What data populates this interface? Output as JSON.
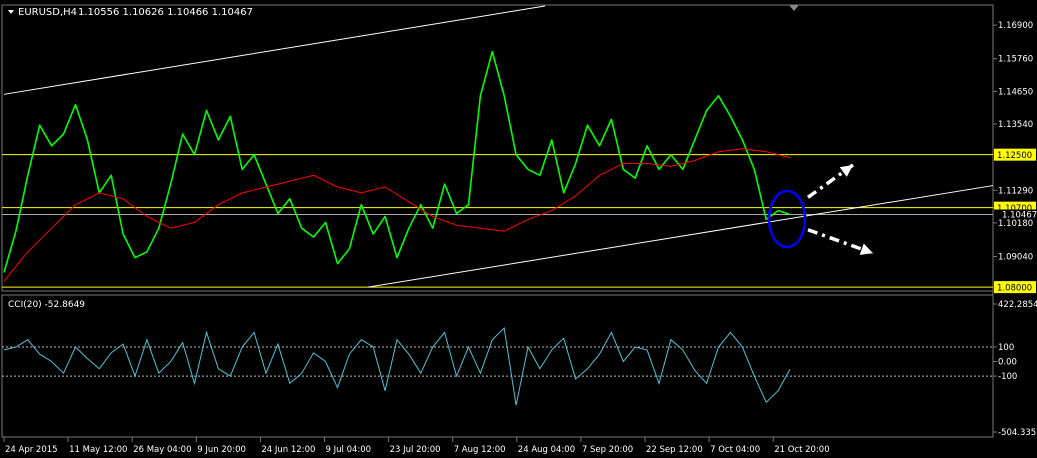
{
  "header": {
    "symbol_label": "EURUSD,H4",
    "ohlc": "1.10556 1.10626 1.10466 1.10467"
  },
  "colors": {
    "background": "#000000",
    "price": "#00ff00",
    "moving_average": "#ff0000",
    "cci": "#4fc3d9",
    "levels": "#ffff00",
    "trendlines": "#ffffff",
    "ellipse": "#0000ff",
    "axis_text": "#ffffff"
  },
  "chart_data": [
    {
      "type": "line",
      "panel": "price",
      "ylim": [
        1.0797,
        1.1755
      ],
      "y_ticks": [
        "1.16900",
        "1.15760",
        "1.14650",
        "1.13540",
        "1.11290",
        "1.10180",
        "1.09040"
      ],
      "level_labels": [
        "1.12500",
        "1.10700",
        "1.08000"
      ],
      "current_label": "1.10467",
      "horizontal_levels": [
        1.125,
        1.107,
        1.08
      ],
      "current_price": 1.10467,
      "series": [
        {
          "role": "price",
          "values": [
            1.085,
            1.099,
            1.118,
            1.135,
            1.128,
            1.132,
            1.142,
            1.13,
            1.112,
            1.118,
            1.098,
            1.09,
            1.092,
            1.1,
            1.115,
            1.132,
            1.125,
            1.14,
            1.13,
            1.138,
            1.12,
            1.125,
            1.115,
            1.105,
            1.11,
            1.1,
            1.097,
            1.102,
            1.088,
            1.093,
            1.108,
            1.098,
            1.104,
            1.09,
            1.1,
            1.108,
            1.1,
            1.115,
            1.105,
            1.108,
            1.145,
            1.16,
            1.145,
            1.125,
            1.12,
            1.118,
            1.13,
            1.112,
            1.122,
            1.135,
            1.128,
            1.137,
            1.12,
            1.117,
            1.128,
            1.12,
            1.125,
            1.12,
            1.13,
            1.14,
            1.145,
            1.138,
            1.13,
            1.12,
            1.103,
            1.106,
            1.1047
          ]
        },
        {
          "role": "moving_average",
          "values": [
            1.082,
            1.092,
            1.1,
            1.108,
            1.112,
            1.11,
            1.104,
            1.1,
            1.102,
            1.108,
            1.112,
            1.114,
            1.116,
            1.118,
            1.114,
            1.112,
            1.114,
            1.109,
            1.104,
            1.101,
            1.1,
            1.099,
            1.103,
            1.106,
            1.111,
            1.118,
            1.122,
            1.122,
            1.121,
            1.123,
            1.126,
            1.127,
            1.126,
            1.124
          ]
        }
      ],
      "trendlines": [
        {
          "start": 1.1455,
          "end": 1.1755
        },
        {
          "start": 1.08,
          "end": 1.1145
        }
      ],
      "projection_arrows": [
        {
          "direction": "up",
          "from": 1.1105,
          "to": 1.1215
        },
        {
          "direction": "down",
          "from": 1.0995,
          "to": 1.0915
        }
      ]
    },
    {
      "type": "line",
      "panel": "oscillator",
      "legend": "CCI(20) -52.8649",
      "ylim": [
        -504.3352,
        422.2854
      ],
      "y_ticks": [
        "422.2854",
        "100",
        "0.00",
        "-100",
        "-504.3352"
      ],
      "reference_levels": [
        100,
        -100
      ],
      "values": [
        80,
        100,
        150,
        50,
        0,
        -80,
        100,
        20,
        -50,
        60,
        120,
        -100,
        150,
        -80,
        0,
        130,
        -150,
        200,
        -50,
        -100,
        100,
        200,
        -80,
        120,
        -150,
        -80,
        60,
        0,
        -180,
        50,
        150,
        100,
        -200,
        150,
        50,
        -80,
        100,
        200,
        -100,
        100,
        -80,
        150,
        230,
        -300,
        100,
        -50,
        80,
        160,
        -120,
        -50,
        50,
        200,
        0,
        100,
        80,
        -150,
        150,
        80,
        -60,
        -150,
        100,
        200,
        100,
        -100,
        -280,
        -200,
        -53
      ]
    }
  ],
  "x_axis": {
    "labels": [
      "24 Apr 2015",
      "11 May 12:00",
      "26 May 04:00",
      "9 Jun 20:00",
      "24 Jun 12:00",
      "9 Jul 04:00",
      "23 Jul 20:00",
      "7 Aug 12:00",
      "24 Aug 04:00",
      "7 Sep 20:00",
      "22 Sep 12:00",
      "7 Oct 04:00",
      "21 Oct 20:00"
    ]
  }
}
